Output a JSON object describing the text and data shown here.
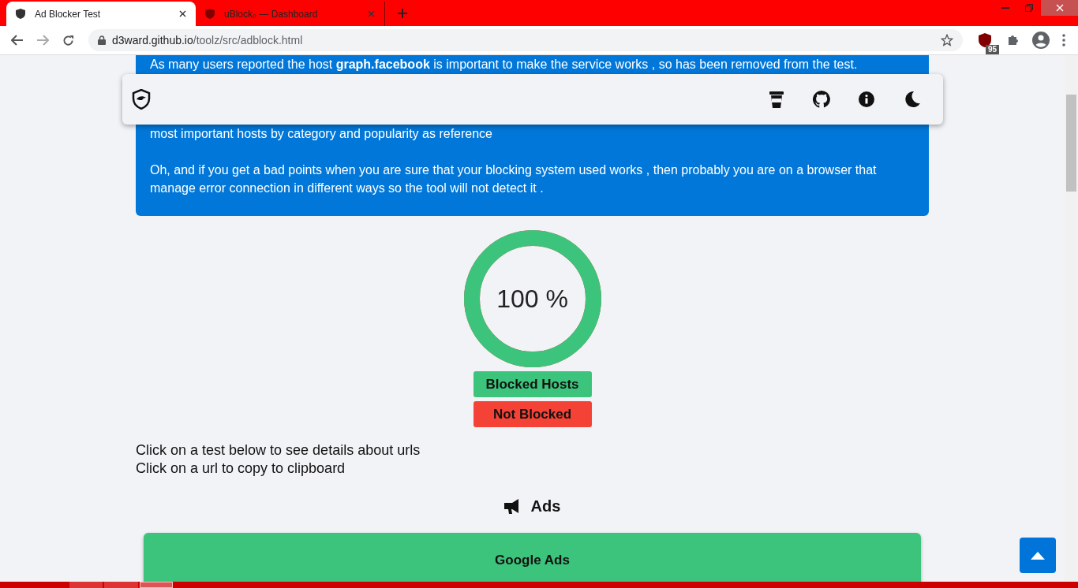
{
  "browser": {
    "tabs": [
      {
        "title": "Ad Blocker Test",
        "selected": true
      },
      {
        "title": "uBlock₀ — Dashboard",
        "selected": false
      }
    ],
    "url_host": "d3ward.github.io",
    "url_path": "/toolz/src/adblock.html",
    "extension_badge": "95"
  },
  "info_box": {
    "first_line": "As many users reported the host **graph.facebook** is important to make the service works , so has been removed from the test.",
    "line_after_header": "most important hosts by category and popularity as reference",
    "last_paragraph": "Oh, and if you get a bad points when you are sure that your blocking system used works , then probably you are on a browser that manage error connection in different ways so the tool will not detect it ."
  },
  "score": {
    "text": "100 %",
    "level": 1
  },
  "legend": [
    {
      "label": "Blocked Hosts",
      "color": "#3cc47c"
    },
    {
      "label": "Not Blocked",
      "color": "#f44336"
    }
  ],
  "instructions": [
    "Click on a test below to see details about urls",
    "Click on a url to copy to clipboard"
  ],
  "section": {
    "title": "Ads",
    "tests": [
      {
        "name": "Google Ads"
      }
    ]
  }
}
